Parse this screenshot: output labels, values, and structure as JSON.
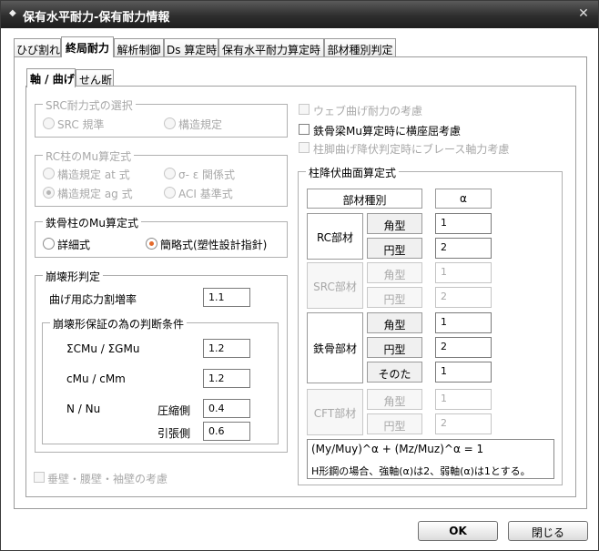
{
  "window": {
    "title": "保有水平耐力-保有耐力情報",
    "close_glyph": "✕",
    "icon_glyph": "◆"
  },
  "tabs": [
    {
      "label": "ひび割れ"
    },
    {
      "label": "終局耐力"
    },
    {
      "label": "解析制御"
    },
    {
      "label": "Ds 算定時"
    },
    {
      "label": "保有水平耐力算定時"
    },
    {
      "label": "部材種別判定"
    }
  ],
  "subtabs": [
    {
      "label": "軸 / 曲げ"
    },
    {
      "label": "せん断"
    }
  ],
  "src": {
    "title": "SRC耐力式の選択",
    "opt1": "SRC 規準",
    "opt2": "構造規定"
  },
  "rc": {
    "title": "RC柱のMu算定式",
    "opt1": "構造規定 at 式",
    "opt2": "σ- ε 関係式",
    "opt3": "構造規定 ag 式",
    "opt4": "ACI 基準式"
  },
  "steel": {
    "title": "鉄骨柱のMu算定式",
    "opt1": "詳細式",
    "opt2": "簡略式(塑性設計指針)"
  },
  "collapse": {
    "title": "崩壊形判定",
    "stress_label": "曲げ用応力割増率",
    "stress_value": "1.1",
    "sub_title": "崩壊形保証の為の判断条件",
    "sum_label": "ΣCMu / ΣGMu",
    "sum_value": "1.2",
    "ratio_label": "cMu / cMm",
    "ratio_value": "1.2",
    "nnu_label": "N / Nu",
    "comp_label": "圧縮側",
    "comp_value": "0.4",
    "tens_label": "引張側",
    "tens_value": "0.6"
  },
  "wall_check": "垂壁・腰壁・袖壁の考慮",
  "checks": {
    "web": "ウェブ曲げ耐力の考慮",
    "lateral": "鉄骨梁Mu算定時に横座屈考慮",
    "brace": "柱脚曲げ降伏判定時にブレース軸力考慮"
  },
  "yield": {
    "title": "柱降伏曲面算定式",
    "col_kind": "部材種別",
    "col_alpha": "α",
    "rc": {
      "label": "RC部材",
      "row1": "角型",
      "val1": "1",
      "row2": "円型",
      "val2": "2"
    },
    "src": {
      "label": "SRC部材",
      "row1": "角型",
      "val1": "1",
      "row2": "円型",
      "val2": "2"
    },
    "steel": {
      "label": "鉄骨部材",
      "row1": "角型",
      "val1": "1",
      "row2": "円型",
      "val2": "2",
      "row3": "そのた",
      "val3": "1"
    },
    "cft": {
      "label": "CFT部材",
      "row1": "角型",
      "val1": "1",
      "row2": "円型",
      "val2": "2"
    },
    "formula": "(My/Muy)^α + (Mz/Muz)^α = 1",
    "note": "H形鋼の場合、強軸(α)は2、弱軸(α)は1とする。"
  },
  "buttons": {
    "ok": "OK",
    "close": "閉じる"
  }
}
